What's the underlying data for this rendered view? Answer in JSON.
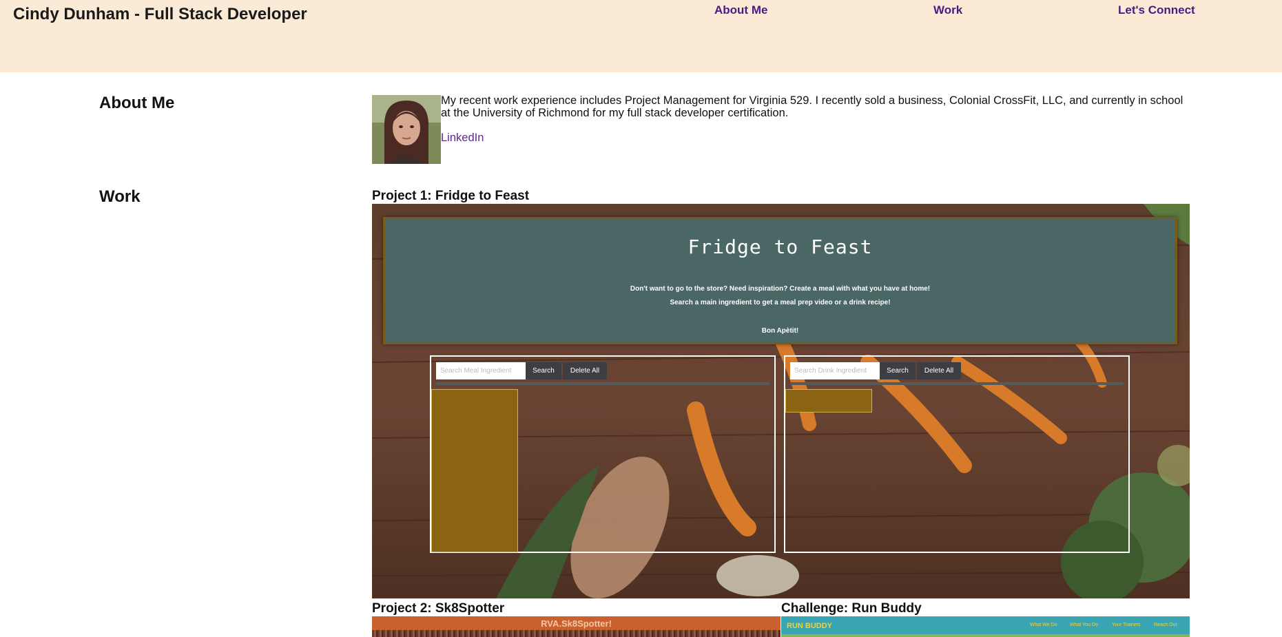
{
  "header": {
    "title": "Cindy Dunham - Full Stack Developer",
    "nav": [
      "About Me",
      "Work",
      "Let's Connect"
    ]
  },
  "about": {
    "heading": "About Me",
    "text": "My recent work experience includes Project Management for Virginia 529. I recently sold a business, Colonial CrossFit, LLC, and currently in school at the University of Richmond for my full stack developer certification.",
    "link_label": "LinkedIn"
  },
  "work": {
    "heading": "Work",
    "project1": {
      "title": "Project 1: Fridge to Feast",
      "app_title": "Fridge to Feast",
      "line1": "Don't want to go to the store? Need inspiration? Create a meal with what you have at home!",
      "line2": "Search a main ingredient to get a meal prep video or a drink recipe!",
      "line3": "Bon Apètit!",
      "meal_placeholder": "Search Meal Ingredient",
      "drink_placeholder": "Search Drink Ingredient",
      "search_label": "Search",
      "delete_label": "Delete All"
    },
    "project2": {
      "title": "Project 2: Sk8Spotter",
      "banner": "RVA.Sk8Spotter!"
    },
    "challenge": {
      "title": "Challenge: Run Buddy",
      "brand": "RUN BUDDY",
      "nav": [
        "What We Do",
        "What You Do",
        "Your Trainers",
        "Reach Out"
      ]
    }
  },
  "colors": {
    "header_bg": "#faead6",
    "nav_link": "#4b1a86",
    "link": "#5a2a86",
    "ff_header": "#4a6766",
    "ff_result": "#8a6412"
  }
}
